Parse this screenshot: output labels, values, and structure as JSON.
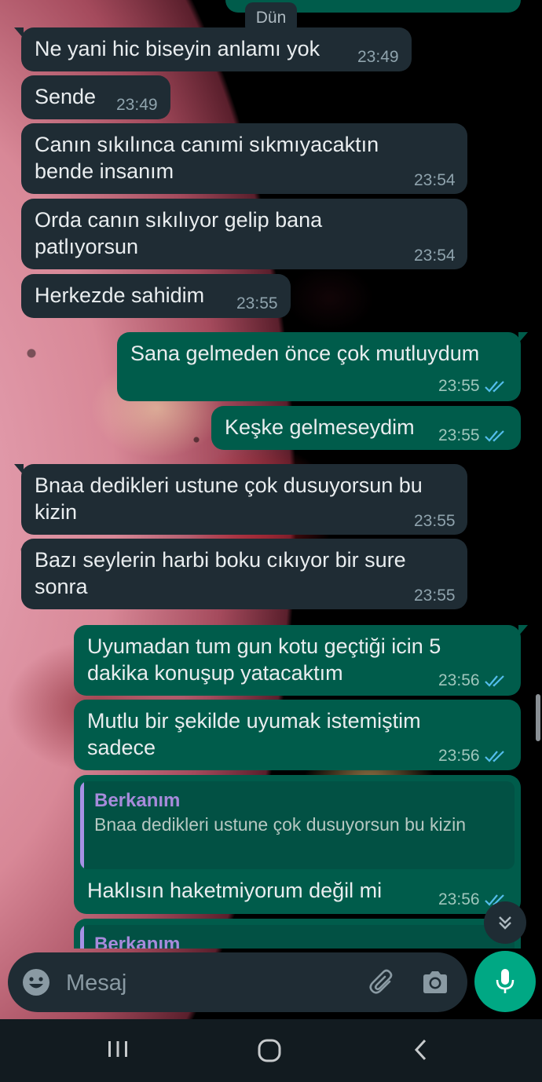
{
  "date_separator": "Dün",
  "messages": [
    {
      "dir": "in",
      "text": "Ne yani hic biseyin anlamı yok",
      "time": "23:49"
    },
    {
      "dir": "in",
      "text": "Sende",
      "time": "23:49"
    },
    {
      "dir": "in",
      "text": "Canın sıkılınca canımi sıkmıyacaktın bende insanım",
      "time": "23:54"
    },
    {
      "dir": "in",
      "text": "Orda canın sıkılıyor gelip bana patlıyorsun",
      "time": "23:54"
    },
    {
      "dir": "in",
      "text": "Herkezde sahidim",
      "time": "23:55"
    },
    {
      "dir": "out",
      "text": "Sana gelmeden önce çok mutluydum",
      "time": "23:55",
      "status": "read"
    },
    {
      "dir": "out",
      "text": "Keşke gelmeseydim",
      "time": "23:55",
      "status": "read"
    },
    {
      "dir": "in",
      "text": "Bnaa dedikleri ustune çok dusuyorsun bu kizin",
      "time": "23:55"
    },
    {
      "dir": "in",
      "text": "Bazı seylerin harbi boku cıkıyor bir sure sonra",
      "time": "23:55"
    },
    {
      "dir": "out",
      "text": "Uyumadan tum gun kotu geçtiği icin 5 dakika konuşup yatacaktım",
      "time": "23:56",
      "status": "read"
    },
    {
      "dir": "out",
      "text": "Mutlu bir şekilde uyumak istemiştim sadece",
      "time": "23:56",
      "status": "read"
    },
    {
      "dir": "out",
      "text": "Haklısın haketmiyorum değil mi",
      "time": "23:56",
      "status": "read",
      "reply": {
        "name": "Berkanım",
        "text": "Bnaa dedikleri ustune çok dusuyorsun bu kizin"
      }
    },
    {
      "dir": "out",
      "partial": true,
      "reply": {
        "name": "Berkanım"
      }
    }
  ],
  "composer": {
    "placeholder": "Mesaj"
  },
  "icons": {
    "emoji": "emoji-icon",
    "attach": "paperclip-icon",
    "camera": "camera-icon",
    "mic": "microphone-icon",
    "scroll": "double-chevron-down-icon",
    "read_ticks": "double-check-icon"
  },
  "colors": {
    "incoming": "#1f2c34",
    "outgoing": "#005c4b",
    "accent": "#00a884",
    "read_ticks": "#53bdeb",
    "reply_name": "#a78bdb"
  }
}
